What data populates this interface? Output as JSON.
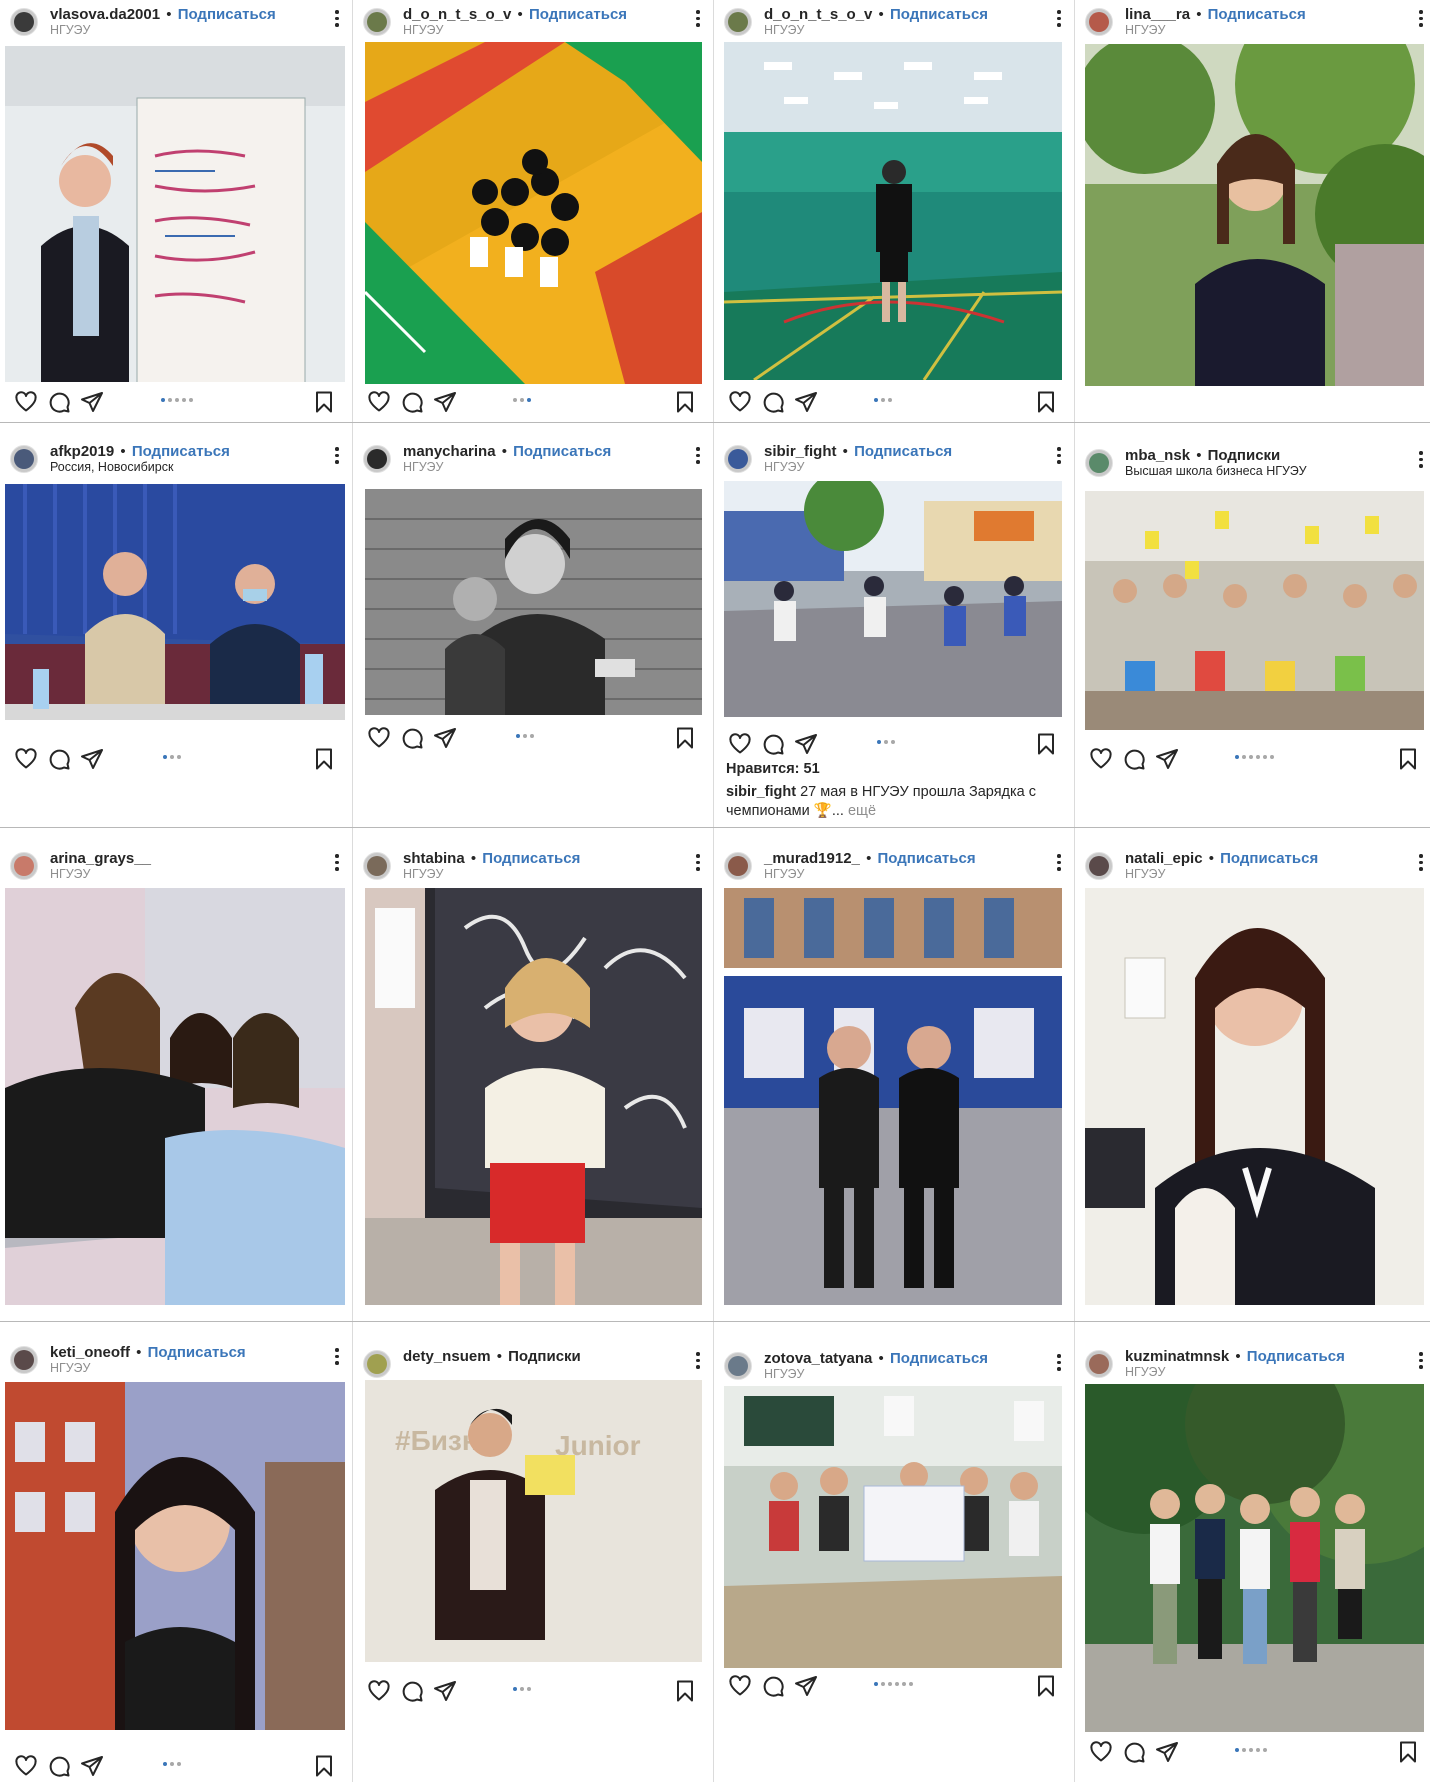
{
  "posts": [
    {
      "username": "vlasova.da2001",
      "follow": "Подписаться",
      "location": "НГУЭУ"
    },
    {
      "username": "d_o_n_t_s_o_v",
      "follow": "Подписаться",
      "location": "НГУЭУ"
    },
    {
      "username": "d_o_n_t_s_o_v",
      "follow": "Подписаться",
      "location": "НГУЭУ"
    },
    {
      "username": "lina___ra",
      "follow": "Подписаться",
      "location": "НГУЭУ"
    },
    {
      "username": "afkp2019",
      "follow": "Подписаться",
      "location": "Россия, Новосибирск"
    },
    {
      "username": "manycharina",
      "follow": "Подписаться",
      "location": "НГУЭУ"
    },
    {
      "username": "sibir_fight",
      "follow": "Подписаться",
      "location": "НГУЭУ",
      "likes": "Нравится: 51",
      "caption_user": "sibir_fight",
      "caption_text": " 27 мая в НГУЭУ прошла Зарядка с чемпионами 🏆... ",
      "caption_more": "ещё"
    },
    {
      "username": "mba_nsk",
      "follow": "Подписки",
      "location": "Высшая школа бизнеса НГУЭУ"
    },
    {
      "username": "arina_grays__",
      "follow": "",
      "location": "НГУЭУ"
    },
    {
      "username": "shtabina",
      "follow": "Подписаться",
      "location": "НГУЭУ"
    },
    {
      "username": "_murad1912_",
      "follow": "Подписаться",
      "location": "НГУЭУ"
    },
    {
      "username": "natali_epic",
      "follow": "Подписаться",
      "location": "НГУЭУ"
    },
    {
      "username": "keti_oneoff",
      "follow": "Подписаться",
      "location": "НГУЭУ"
    },
    {
      "username": "dety_nsuem",
      "follow": "Подписки",
      "location": ""
    },
    {
      "username": "zotova_tatyana",
      "follow": "Подписаться",
      "location": "НГУЭУ"
    },
    {
      "username": "kuzminatmnsk",
      "follow": "Подписаться",
      "location": "НГУЭУ"
    }
  ],
  "icons": {
    "like": "heart-icon",
    "comment": "comment-icon",
    "share": "share-icon",
    "save": "bookmark-icon",
    "more": "more-options-icon"
  },
  "colors": {
    "link": "#3b76b9",
    "text": "#262626",
    "secondary": "#8e8e8e"
  }
}
